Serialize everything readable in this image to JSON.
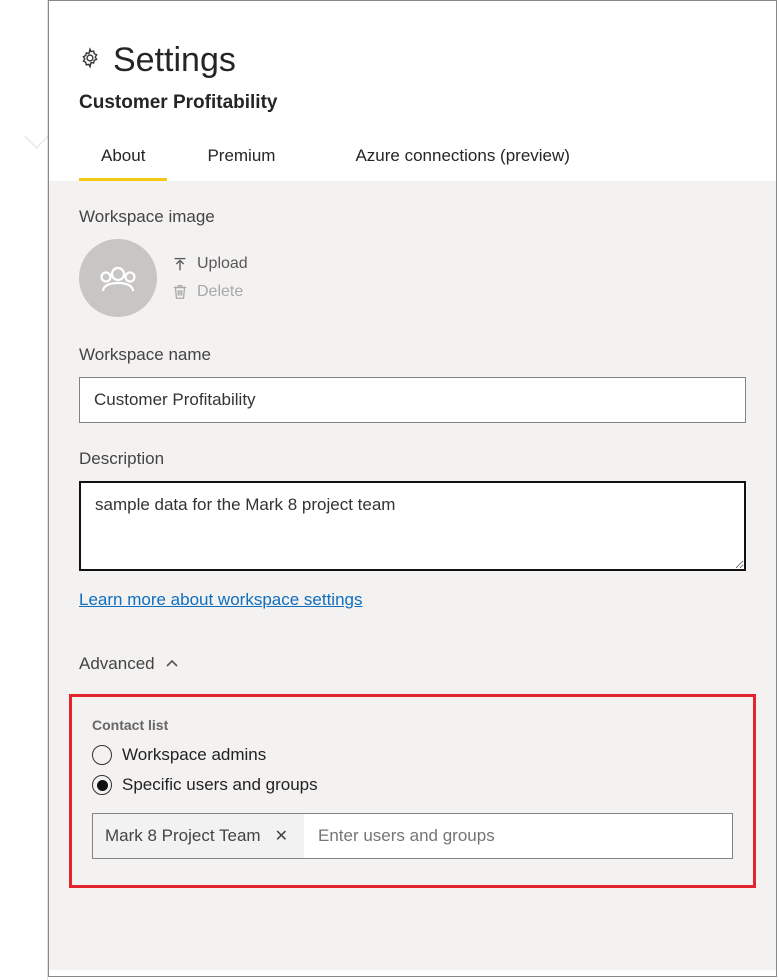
{
  "header": {
    "title": "Settings",
    "subtitle": "Customer Profitability"
  },
  "tabs": [
    {
      "label": "About",
      "active": true
    },
    {
      "label": "Premium",
      "active": false
    },
    {
      "label": "Azure connections (preview)",
      "active": false
    }
  ],
  "workspaceImage": {
    "label": "Workspace image",
    "uploadLabel": "Upload",
    "deleteLabel": "Delete"
  },
  "workspaceName": {
    "label": "Workspace name",
    "value": "Customer Profitability"
  },
  "description": {
    "label": "Description",
    "value": "sample data for the Mark 8 project team"
  },
  "learnMoreLink": "Learn more about workspace settings",
  "advanced": {
    "label": "Advanced"
  },
  "contactList": {
    "label": "Contact list",
    "options": [
      {
        "label": "Workspace admins",
        "checked": false
      },
      {
        "label": "Specific users and groups",
        "checked": true
      }
    ],
    "chip": "Mark 8 Project Team",
    "placeholder": "Enter users and groups"
  }
}
